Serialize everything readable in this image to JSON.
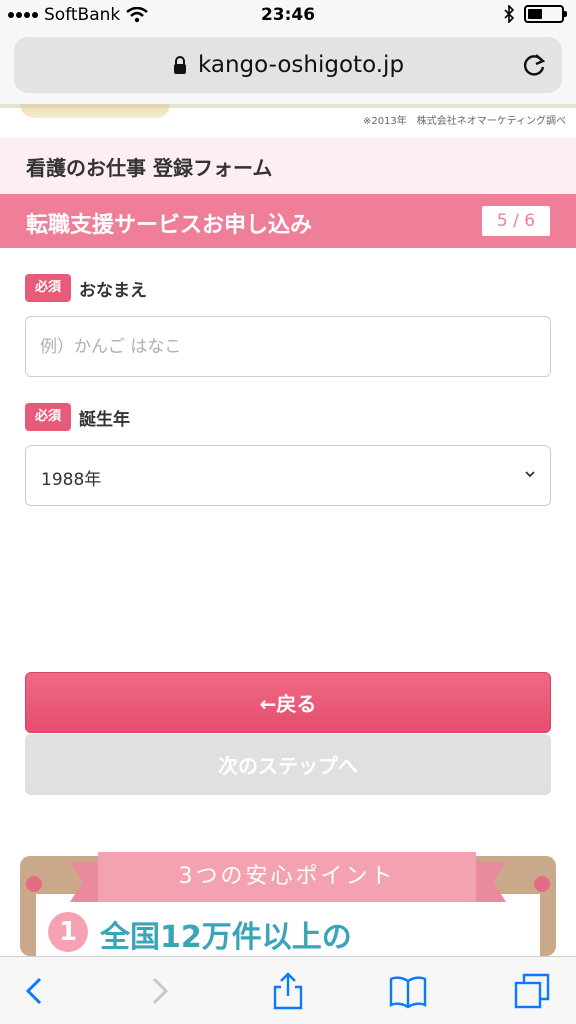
{
  "status_bar": {
    "carrier": "SoftBank",
    "time": "23:46"
  },
  "browser": {
    "url": "kango-oshigoto.jp"
  },
  "banner": {
    "note": "※2013年　株式会社ネオマーケティング調べ"
  },
  "form": {
    "title": "看護のお仕事 登録フォーム",
    "step_title": "転職支援サービスお申し込み",
    "step_counter": "5 / 6",
    "fields": [
      {
        "badge": "必須",
        "label": "おなまえ",
        "placeholder": "例）かんご はなこ",
        "value": ""
      },
      {
        "badge": "必須",
        "label": "誕生年",
        "value": "1988年"
      }
    ],
    "back_button": "←戻る",
    "next_button": "次のステップへ"
  },
  "promo": {
    "ribbon": "3つの安心ポイント",
    "number": "1",
    "headline": "全国12万件以上の"
  },
  "icons": {
    "lock": "lock-icon",
    "reload": "reload-icon",
    "back": "back-arrow-icon",
    "forward": "forward-arrow-icon",
    "share": "share-icon",
    "bookmarks": "bookmarks-icon",
    "tabs": "tabs-icon"
  },
  "colors": {
    "accent": "#ef7f98",
    "button": "#e54d6e",
    "disabled": "#e0e0e0",
    "toolbar_blue": "#0a7aff"
  }
}
